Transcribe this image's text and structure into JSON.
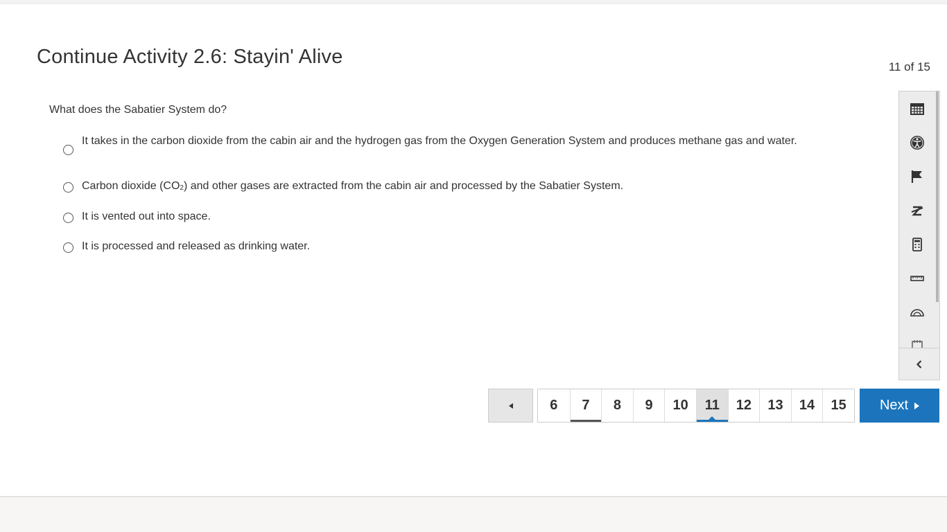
{
  "header": {
    "title": "Continue Activity 2.6: Stayin' Alive",
    "progress": "11 of 15"
  },
  "question": {
    "prompt": "What does the Sabatier System do?",
    "options": [
      {
        "label": "It takes in the carbon dioxide from the cabin air and the hydrogen gas from the Oxygen Generation System and produces methane gas and water."
      },
      {
        "label_pre": "Carbon dioxide (CO",
        "label_sub": "2",
        "label_post": ") and other gases are extracted from the cabin air and processed by the Sabatier System."
      },
      {
        "label": "It is vented out into space."
      },
      {
        "label": "It is processed and released as drinking water."
      }
    ]
  },
  "tools": [
    {
      "icon": "calendar-grid-icon"
    },
    {
      "icon": "accessibility-icon"
    },
    {
      "icon": "flag-icon"
    },
    {
      "icon": "strikethrough-eliminator-icon"
    },
    {
      "icon": "calculator-icon"
    },
    {
      "icon": "ruler-icon"
    },
    {
      "icon": "protractor-icon"
    },
    {
      "icon": "notepad-icon"
    }
  ],
  "pagination": {
    "prev_icon": "triangle-left-icon",
    "pages": [
      "6",
      "7",
      "8",
      "9",
      "10",
      "11",
      "12",
      "13",
      "14",
      "15"
    ],
    "visited_page": "7",
    "current_page": "11",
    "next_label": "Next"
  },
  "colors": {
    "accent": "#1c75bc",
    "current_page_bg": "#e0e0e0",
    "visited_underline": "#555555"
  }
}
